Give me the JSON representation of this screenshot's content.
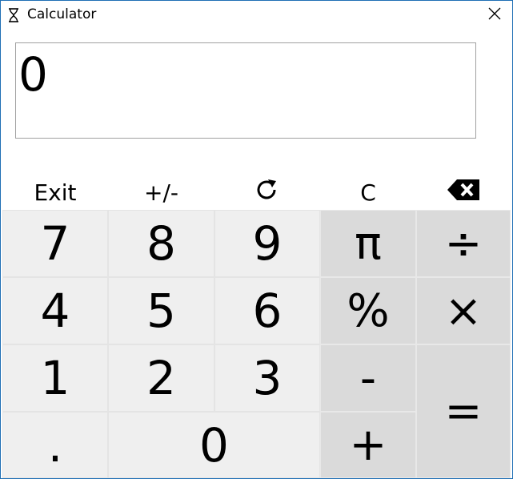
{
  "window": {
    "title": "Calculator",
    "icon": "hourglass-icon",
    "close_icon": "close-icon"
  },
  "display": {
    "value": "0"
  },
  "function_row": {
    "exit": "Exit",
    "sign": "+/-",
    "refresh_icon": "refresh-icon",
    "clear": "C",
    "backspace_icon": "backspace-icon"
  },
  "keypad": {
    "seven": "7",
    "eight": "8",
    "nine": "9",
    "four": "4",
    "five": "5",
    "six": "6",
    "one": "1",
    "two": "2",
    "three": "3",
    "dot": ".",
    "zero": "0"
  },
  "operators": {
    "pi": "π",
    "divide": "÷",
    "percent": "%",
    "multiply": "×",
    "minus": "-",
    "equals": "=",
    "plus": "+"
  },
  "colors": {
    "window_border": "#1f6fb5",
    "number_key_bg": "#efefef",
    "operator_key_bg": "#dadada"
  }
}
